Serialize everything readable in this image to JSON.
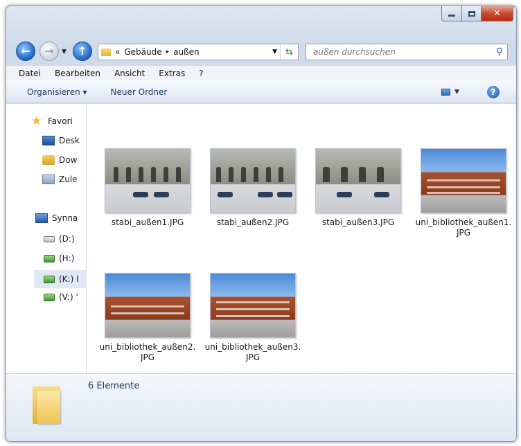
{
  "window": {
    "caption_buttons": {
      "minimize": "",
      "maximize": "",
      "close": "✕"
    }
  },
  "navigation": {
    "back_icon": "back-arrow-icon",
    "forward_icon": "forward-arrow-icon",
    "up_icon": "up-arrow-icon"
  },
  "address": {
    "overflow": "«",
    "parts": [
      "Gebäude",
      "außen"
    ],
    "separator": "▸"
  },
  "search": {
    "placeholder": "außen durchsuchen"
  },
  "menubar": {
    "items": [
      "Datei",
      "Bearbeiten",
      "Ansicht",
      "Extras",
      "?"
    ]
  },
  "commandbar": {
    "organize": "Organisieren ▾",
    "new_folder": "Neuer Ordner",
    "help": "?"
  },
  "sidebar": {
    "favorites": {
      "label": "Favori",
      "items": [
        "Desk",
        "Dow",
        "Zule"
      ]
    },
    "network": {
      "label": "Synna"
    },
    "drives": [
      "(D:)",
      "(H:)",
      "(K:) I",
      "(V:) '"
    ]
  },
  "files": [
    {
      "name": "stabi_außen1.JPG",
      "kind": "stabi"
    },
    {
      "name": "stabi_außen2.JPG",
      "kind": "stabi"
    },
    {
      "name": "stabi_außen3.JPG",
      "kind": "stabi"
    },
    {
      "name": "uni_bibliothek_außen1.JPG",
      "kind": "uni"
    },
    {
      "name": "uni_bibliothek_außen2.JPG",
      "kind": "uni"
    },
    {
      "name": "uni_bibliothek_außen3.JPG",
      "kind": "uni"
    }
  ],
  "status": {
    "count_text": "6 Elemente"
  },
  "colors": {
    "accent": "#1e395b",
    "selection": "#dfe8f4",
    "folder": "#f0c453"
  }
}
